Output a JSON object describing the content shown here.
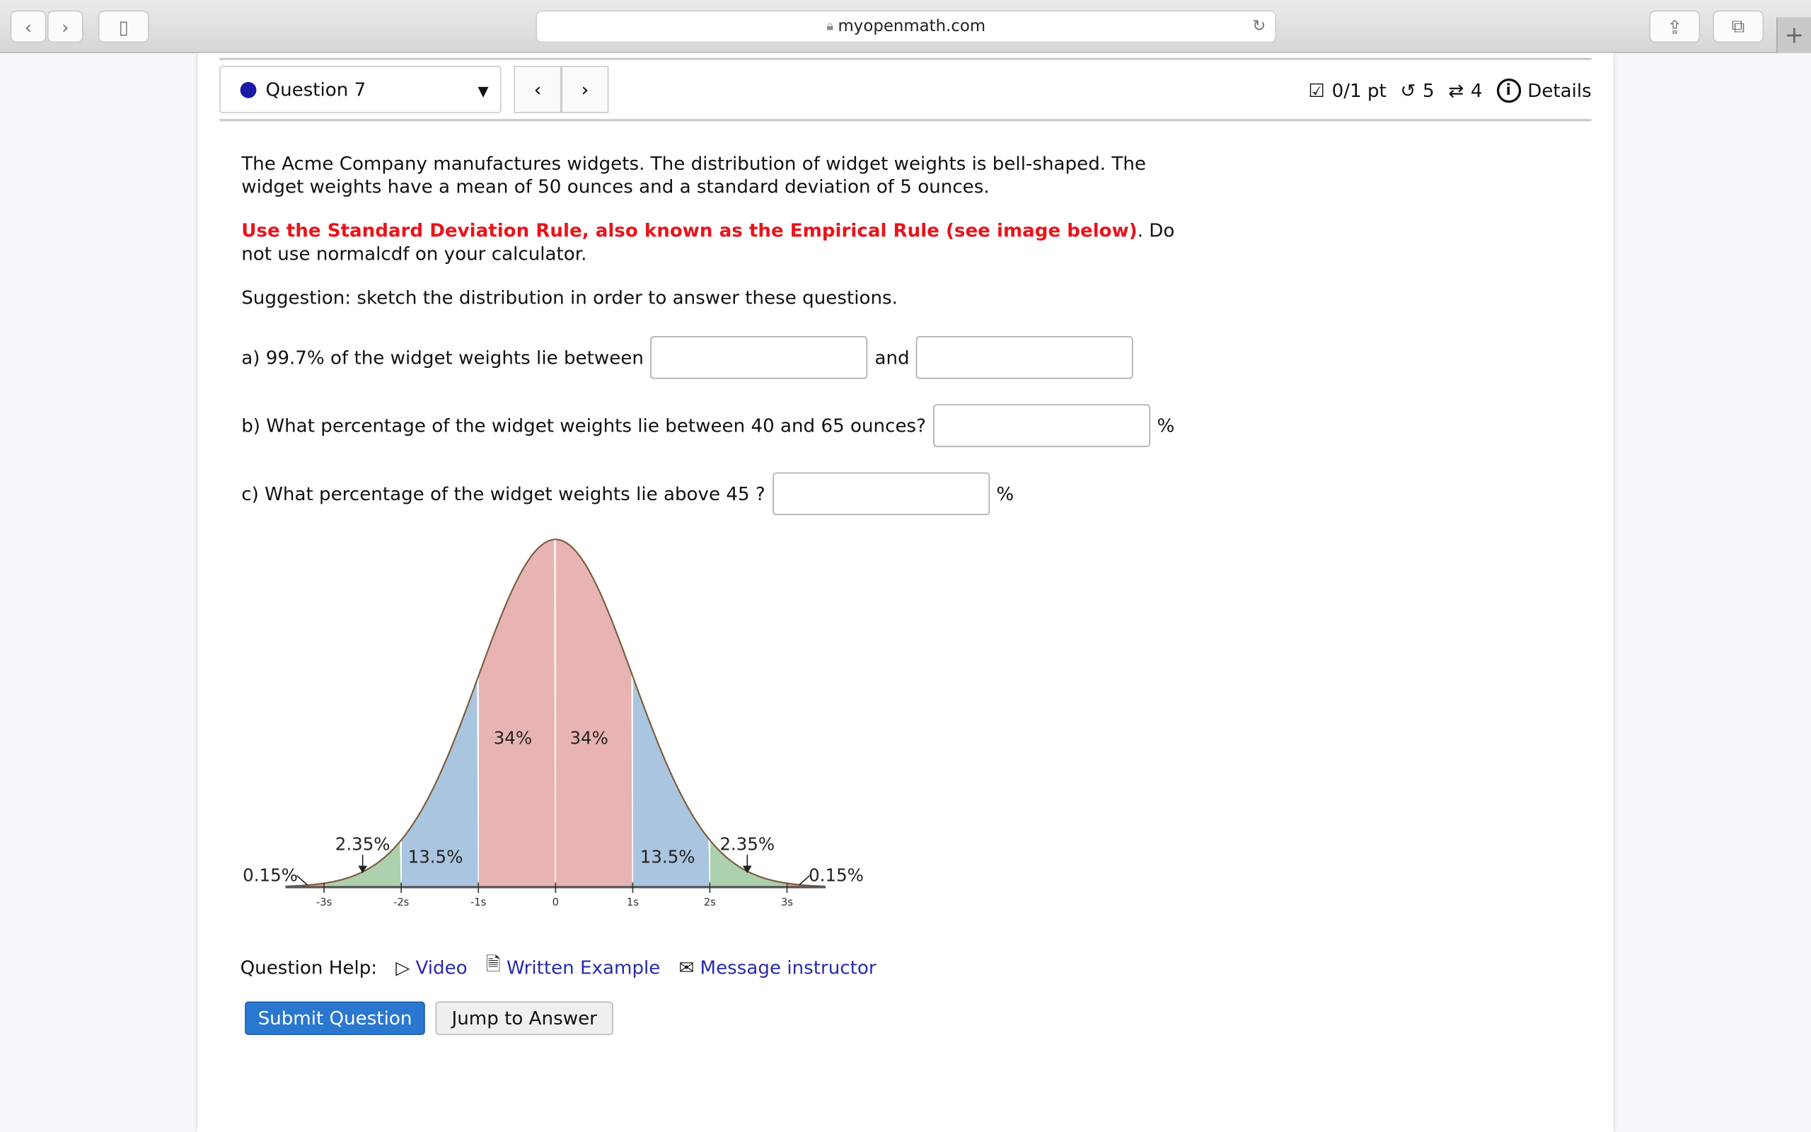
{
  "browser": {
    "url": "myopenmath.com",
    "icons": [
      "back-icon",
      "forward-icon",
      "sidebar-icon",
      "lock-icon",
      "reload-icon",
      "share-icon",
      "tabs-icon",
      "new-tab-icon"
    ]
  },
  "header": {
    "question_select": "Question 7",
    "score": "0/1 pt",
    "retries": "5",
    "attempts": "4",
    "details": "Details"
  },
  "question": {
    "intro": "The Acme Company manufactures widgets. The distribution of widget weights is bell-shaped. The widget weights have a mean of 50 ounces and a standard deviation of 5 ounces.",
    "instruction_red": "Use the Standard Deviation Rule, also known as the Empirical Rule (see image below)",
    "instruction_rest": ".  Do not use normalcdf on your calculator.",
    "suggestion": "Suggestion: sketch the distribution in order to answer these questions.",
    "a_label": "a) 99.7% of the widget weights lie between",
    "a_and": "and",
    "b_label": "b) What percentage of the widget weights lie between 40 and 65 ounces?",
    "b_unit": "%",
    "c_label": "c) What percentage of the widget weights lie above 45 ?",
    "c_unit": "%",
    "inputs": {
      "a1": "",
      "a2": "",
      "b": "",
      "c": ""
    }
  },
  "diagram": {
    "ticks": [
      "-3s",
      "-2s",
      "-1s",
      "0",
      "1s",
      "2s",
      "3s"
    ],
    "labels": {
      "center_left": "34%",
      "center_right": "34%",
      "mid_left": "13.5%",
      "mid_right": "13.5%",
      "outer_left": "2.35%",
      "outer_right": "2.35%",
      "tail_left": "0.15%",
      "tail_right": "0.15%"
    },
    "colors": {
      "center": "#e8b4b3",
      "middle": "#aac5df",
      "outer": "#add0ad",
      "tail": "#e8a56a"
    }
  },
  "help": {
    "label": "Question Help:",
    "video": "Video",
    "written": "Written Example",
    "message": "Message instructor"
  },
  "buttons": {
    "submit": "Submit Question",
    "jump": "Jump to Answer"
  },
  "colors": {
    "accent": "#2a77d0",
    "link": "#2a2aa8",
    "red": "#e8141b"
  }
}
